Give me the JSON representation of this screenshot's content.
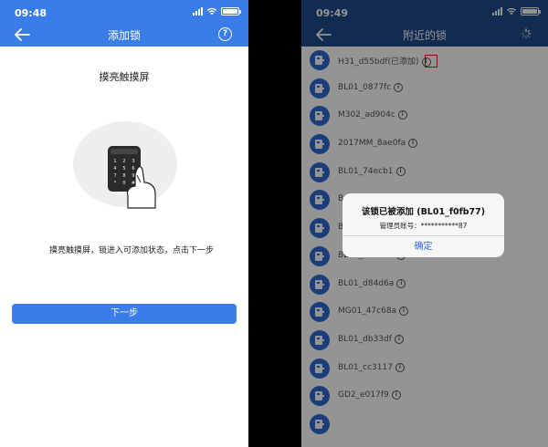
{
  "left_screen": {
    "status_time": "09:48",
    "title": "添加锁",
    "help_icon": "?",
    "instruction_title": "摸亮触摸屏",
    "keypad_keys": [
      "1",
      "2",
      "3",
      "4",
      "5",
      "6",
      "7",
      "8",
      "9",
      "*",
      "0",
      "#"
    ],
    "description": "摸亮触摸屏，锁进入可添加状态，点击下一步",
    "next_button": "下一步"
  },
  "right_screen": {
    "status_time": "09:49",
    "title": "附近的锁",
    "locks": [
      {
        "name": "H31_d55bdf(已添加)"
      },
      {
        "name": "BL01_0877fc"
      },
      {
        "name": "M302_ad904c"
      },
      {
        "name": "2017MM_8ae0fa"
      },
      {
        "name": "BL01_74ecb1"
      },
      {
        "name": "B"
      },
      {
        "name": "B"
      },
      {
        "name": "BL01_55b4ce"
      },
      {
        "name": "BL01_d84d6a"
      },
      {
        "name": "MG01_47c68a"
      },
      {
        "name": "BL01_db33df"
      },
      {
        "name": "BL01_cc3117"
      },
      {
        "name": "GD2_e017f9"
      },
      {
        "name": ""
      }
    ],
    "info_icon": "i",
    "alert": {
      "title": "该锁已被添加 (BL01_f0fb77)",
      "message": "管理员账号：***********87",
      "confirm": "确定"
    }
  },
  "colors": {
    "primary": "#3a7de8",
    "lock_icon_bg": "#2f6cd2",
    "highlight": "#d62020"
  }
}
